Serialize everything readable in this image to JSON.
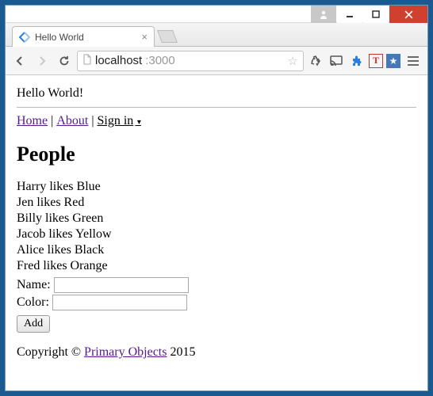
{
  "window": {
    "tab_title": "Hello World"
  },
  "toolbar": {
    "url_host": "localhost",
    "url_port": ":3000"
  },
  "page": {
    "greeting": "Hello World!",
    "nav": {
      "home": "Home",
      "about": "About",
      "signin": "Sign in"
    },
    "heading": "People",
    "people": [
      "Harry likes Blue",
      "Jen likes Red",
      "Billy likes Green",
      "Jacob likes Yellow",
      "Alice likes Black",
      "Fred likes Orange"
    ],
    "form": {
      "name_label": "Name:",
      "name_value": "",
      "color_label": "Color:",
      "color_value": "",
      "add_label": "Add"
    },
    "footer": {
      "prefix": "Copyright © ",
      "link": "Primary Objects",
      "suffix": " 2015"
    }
  }
}
